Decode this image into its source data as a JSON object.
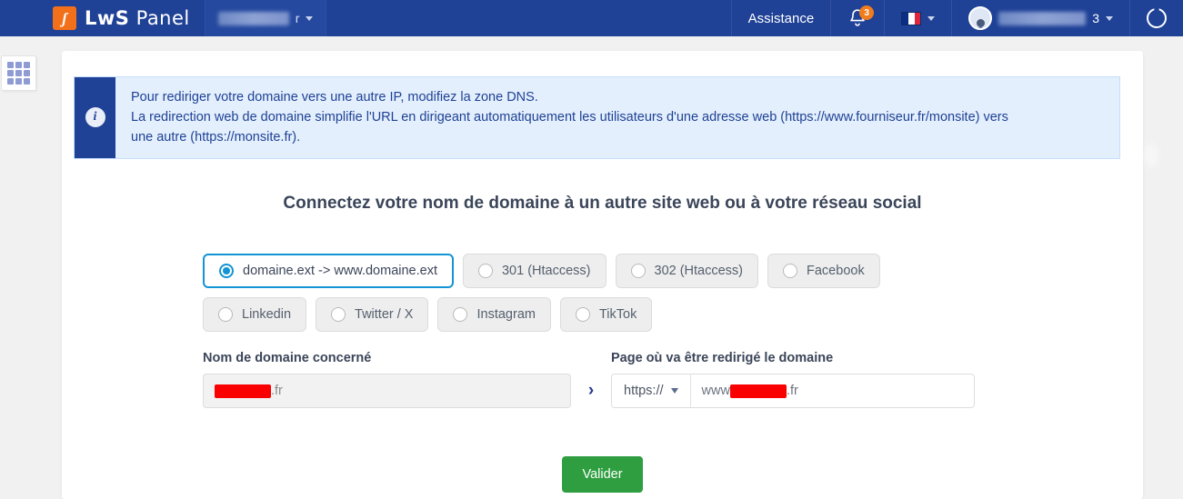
{
  "header": {
    "brand_prefix": "LwS",
    "brand_suffix": "Panel",
    "logo_glyph": "ʃ",
    "tab_suffix": "r",
    "assistance_label": "Assistance",
    "notification_count": "3",
    "user_suffix": "3",
    "colors": {
      "nav_bg": "#1f4196",
      "badge": "#f07c1e",
      "logo": "#f3701b"
    }
  },
  "sidebar": {
    "grid_icon": "apps-grid-icon"
  },
  "banner": {
    "icon": "info-icon",
    "line1": "Pour rediriger votre domaine vers une autre IP, modifiez la zone DNS.",
    "line2": "La redirection web de domaine simplifie l'URL en dirigeant automatiquement les utilisateurs d'une adresse web (https://www.fourniseur.fr/monsite) vers",
    "line3": "une autre (https://monsite.fr)."
  },
  "main": {
    "heading": "Connectez votre nom de domaine à un autre site web ou à votre réseau social",
    "options_row1": [
      {
        "label": "domaine.ext -> www.domaine.ext",
        "selected": true
      },
      {
        "label": "301 (Htaccess)",
        "selected": false
      },
      {
        "label": "302 (Htaccess)",
        "selected": false
      },
      {
        "label": "Facebook",
        "selected": false
      }
    ],
    "options_row2": [
      {
        "label": "Linkedin",
        "selected": false
      },
      {
        "label": "Twitter / X",
        "selected": false
      },
      {
        "label": "Instagram",
        "selected": false
      },
      {
        "label": "TikTok",
        "selected": false
      }
    ],
    "accent_selected": "#1394d4",
    "fields": {
      "domain_label": "Nom de domaine concerné",
      "domain_value_suffix": ".fr",
      "separator": "›",
      "target_label": "Page où va être redirigé le domaine",
      "protocol_value": "https://",
      "target_prefix": "www",
      "target_suffix": ".fr"
    },
    "submit_label": "Valider",
    "submit_color": "#2f9e41"
  }
}
